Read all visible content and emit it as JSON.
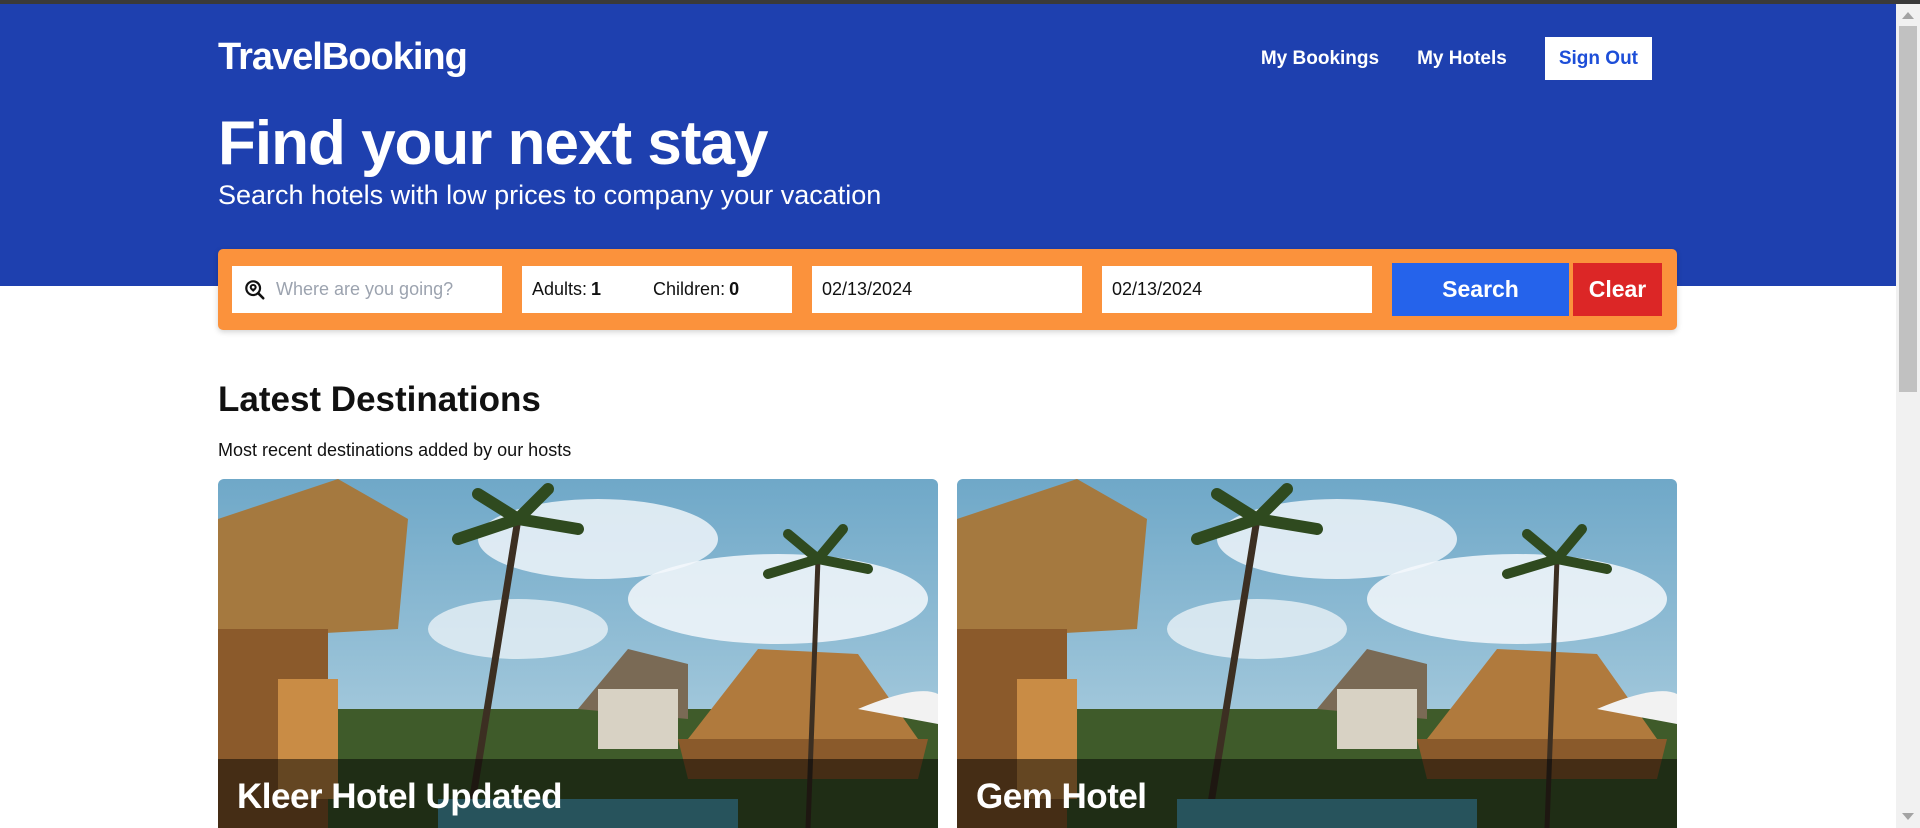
{
  "header": {
    "brand": "TravelBooking",
    "nav": {
      "my_bookings": "My Bookings",
      "my_hotels": "My Hotels",
      "sign_out": "Sign Out"
    }
  },
  "hero": {
    "title": "Find your next stay",
    "subtitle": "Search hotels with low prices to company your vacation"
  },
  "search": {
    "destination_placeholder": "Where are you going?",
    "adults_label": "Adults:",
    "adults_value": "1",
    "children_label": "Children:",
    "children_value": "0",
    "check_in": "02/13/2024",
    "check_out": "02/13/2024",
    "search_label": "Search",
    "clear_label": "Clear"
  },
  "destinations": {
    "title": "Latest Destinations",
    "subtitle": "Most recent destinations added by our hosts",
    "cards": [
      {
        "name": "Kleer Hotel Updated"
      },
      {
        "name": "Gem Hotel"
      }
    ]
  },
  "colors": {
    "hero_bg": "#1e40af",
    "search_bar_bg": "#fb923c",
    "search_button": "#2563eb",
    "clear_button": "#dc2626"
  },
  "icons": {
    "destination": "search-location-icon"
  }
}
